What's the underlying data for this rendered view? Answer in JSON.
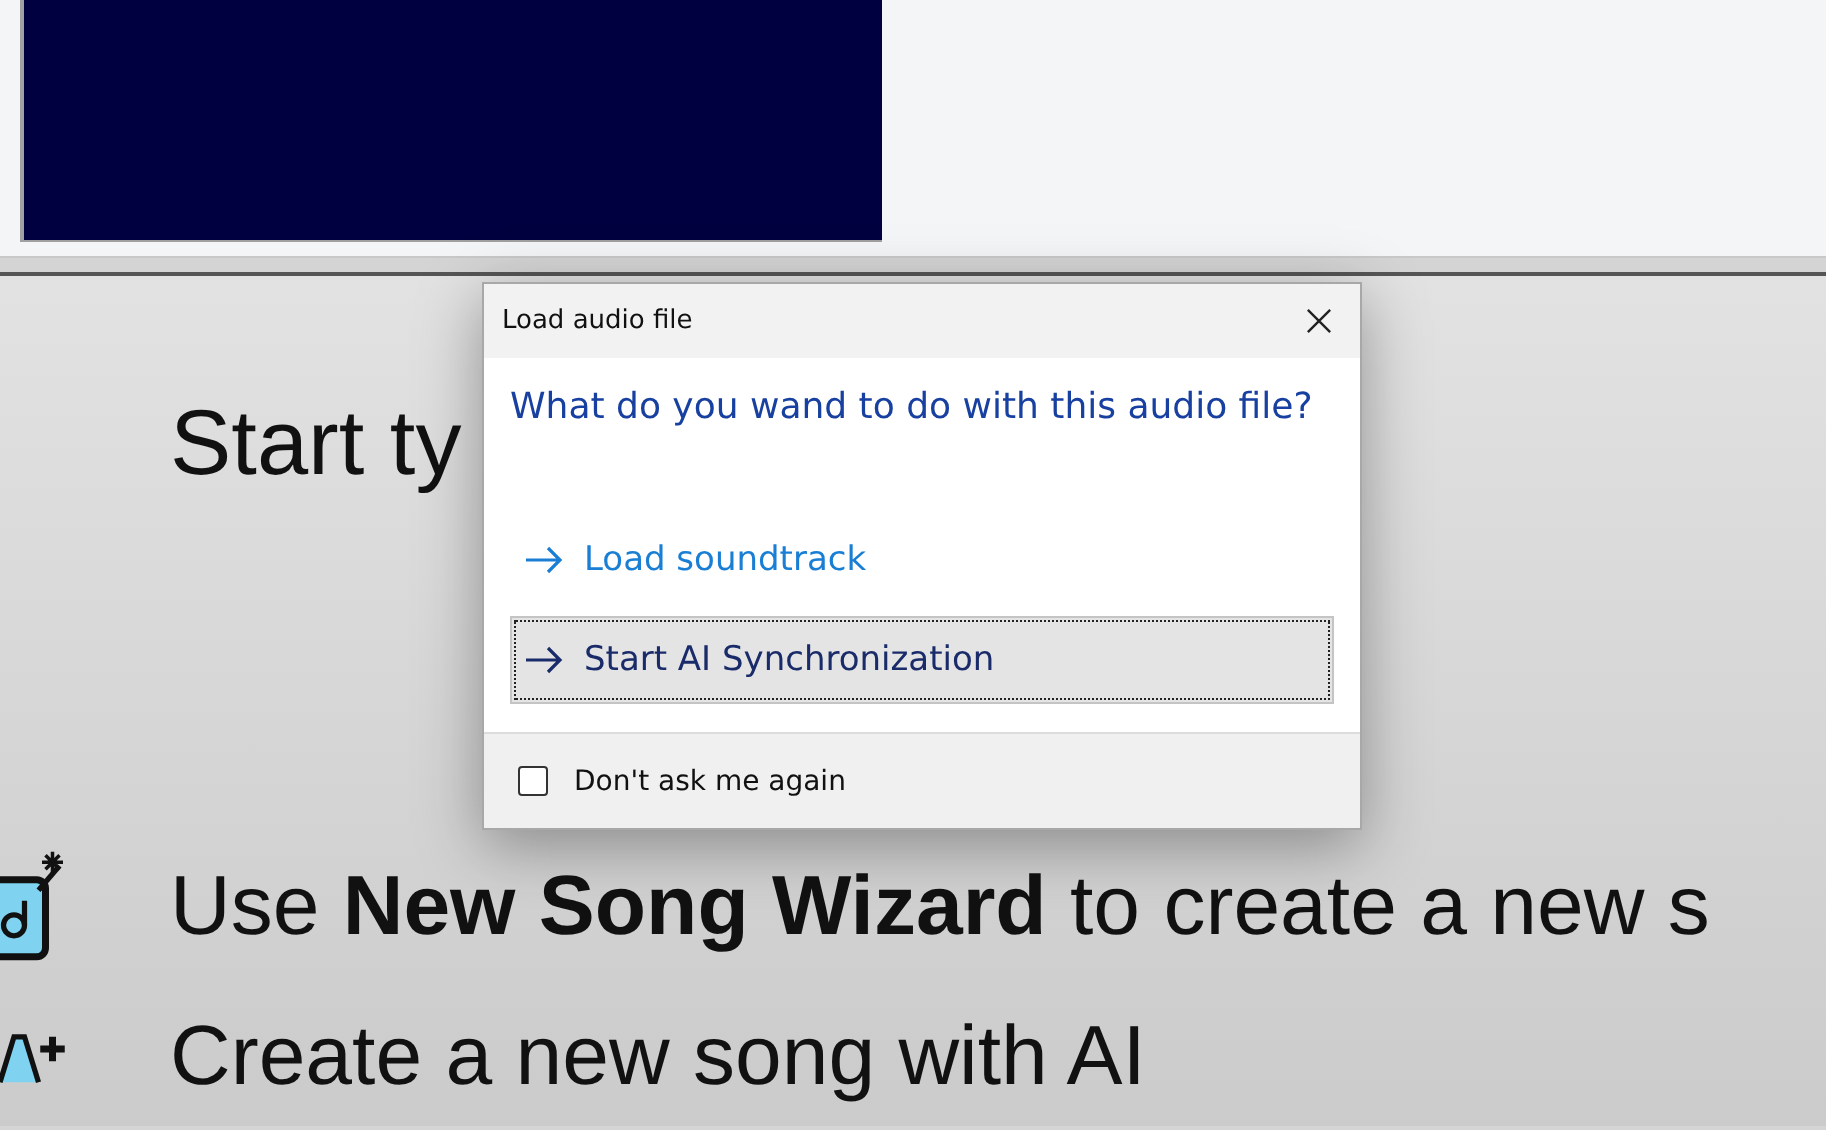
{
  "page": {
    "heading": "Start ty",
    "items": [
      {
        "kind": "wizard",
        "text": "Use **New Song Wizard** to create a new s"
      },
      {
        "kind": "ai",
        "text": "Create a new song with AI"
      }
    ]
  },
  "dialog": {
    "title": "Load audio file",
    "question": "What do you wand to do with this audio file?",
    "options": [
      {
        "label": "Load soundtrack",
        "selected": false
      },
      {
        "label": "Start AI Synchronization",
        "selected": true
      }
    ],
    "checkbox": {
      "label": "Don't ask me again",
      "checked": false
    }
  }
}
